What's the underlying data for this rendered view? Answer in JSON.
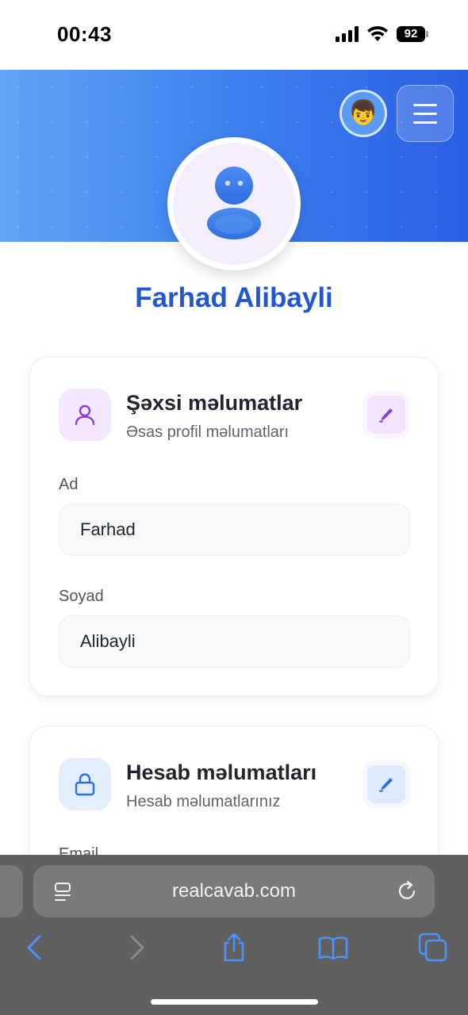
{
  "status_bar": {
    "time": "00:43",
    "battery": "92"
  },
  "header": {
    "avatar_emoji": "👦",
    "menu_icon": "hamburger-icon"
  },
  "profile": {
    "name": "Farhad Alibayli"
  },
  "personal_card": {
    "title": "Şəxsi məlumatlar",
    "subtitle": "Əsas profil məlumatları",
    "icon": "user-icon",
    "edit_icon": "pencil-icon",
    "fields": [
      {
        "label": "Ad",
        "value": "Farhad"
      },
      {
        "label": "Soyad",
        "value": "Alibayli"
      }
    ]
  },
  "account_card": {
    "title": "Hesab məlumatları",
    "subtitle": "Hesab məlumatlarınız",
    "icon": "lock-icon",
    "edit_icon": "pencil-icon",
    "fields": [
      {
        "label": "Email"
      }
    ]
  },
  "browser": {
    "url": "realcavab.com",
    "icons": [
      "reader-icon",
      "reload-icon",
      "back-icon",
      "forward-icon",
      "share-icon",
      "bookmarks-icon",
      "tabs-icon"
    ]
  },
  "colors": {
    "accent": "#2357cf",
    "banner_start": "#63a4f7",
    "banner_end": "#2b5fe4",
    "purple": "#8b3fd9",
    "blue": "#2f6fe0"
  }
}
